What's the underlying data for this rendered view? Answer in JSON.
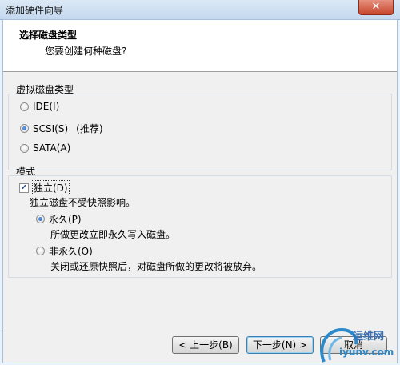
{
  "window": {
    "title": "添加硬件向导",
    "close_glyph": "✕"
  },
  "header": {
    "title": "选择磁盘类型",
    "subtitle": "您要创建何种磁盘?"
  },
  "disk_type": {
    "label": "虚拟磁盘类型",
    "options": [
      {
        "label": "IDE(I)",
        "checked": false
      },
      {
        "label": "SCSI(S)",
        "note": "(推荐)",
        "checked": true
      },
      {
        "label": "SATA(A)",
        "checked": false
      }
    ]
  },
  "mode": {
    "label": "模式",
    "independent": {
      "label": "独立(D)",
      "checked": true,
      "desc": "独立磁盘不受快照影响。"
    },
    "options": [
      {
        "label": "永久(P)",
        "checked": true,
        "desc": "所做更改立即永久写入磁盘。"
      },
      {
        "label": "非永久(O)",
        "checked": false,
        "desc": "关闭或还原快照后，对磁盘所做的更改将被放弃。"
      }
    ]
  },
  "buttons": {
    "back": "< 上一步(B)",
    "next": "下一步(N) >",
    "cancel": "取消"
  },
  "watermark": {
    "line1": "运维网",
    "line2": "iyunv.com"
  }
}
